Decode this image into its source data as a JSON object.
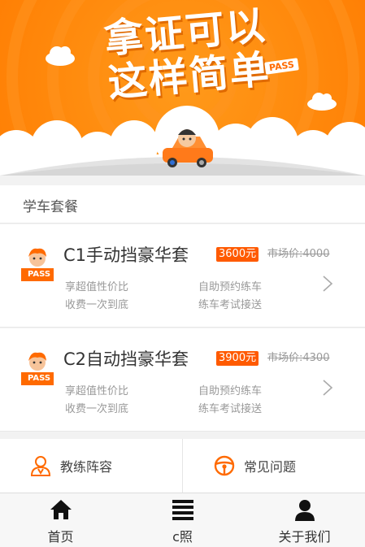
{
  "banner": {
    "slogan_line1": "拿证可以",
    "slogan_line2": "这样简单",
    "pass_tag": "PASS",
    "brand_color": "#ff8a00"
  },
  "section": {
    "title": "学车套餐"
  },
  "packages": [
    {
      "badge": "PASS",
      "name": "C1手动挡豪华套",
      "price": "3600元",
      "market_price": "市场价:4000",
      "features": [
        "享超值性价比",
        "自助预约练车",
        "收费一次到底",
        "练车考试接送"
      ]
    },
    {
      "badge": "PASS",
      "name": "C2自动挡豪华套",
      "price": "3900元",
      "market_price": "市场价:4300",
      "features": [
        "享超值性价比",
        "自助预约练车",
        "收费一次到底",
        "练车考试接送"
      ]
    }
  ],
  "links": {
    "coaches": {
      "label": "教练阵容",
      "icon": "coach-icon"
    },
    "faq": {
      "label": "常见问题",
      "icon": "steering-wheel-icon"
    }
  },
  "tabbar": {
    "home": {
      "label": "首页",
      "icon": "home-icon"
    },
    "license": {
      "label": "c照",
      "icon": "list-icon"
    },
    "about": {
      "label": "关于我们",
      "icon": "user-icon"
    }
  },
  "colors": {
    "accent": "#ff6a00",
    "price_bg": "#ff5a00"
  }
}
